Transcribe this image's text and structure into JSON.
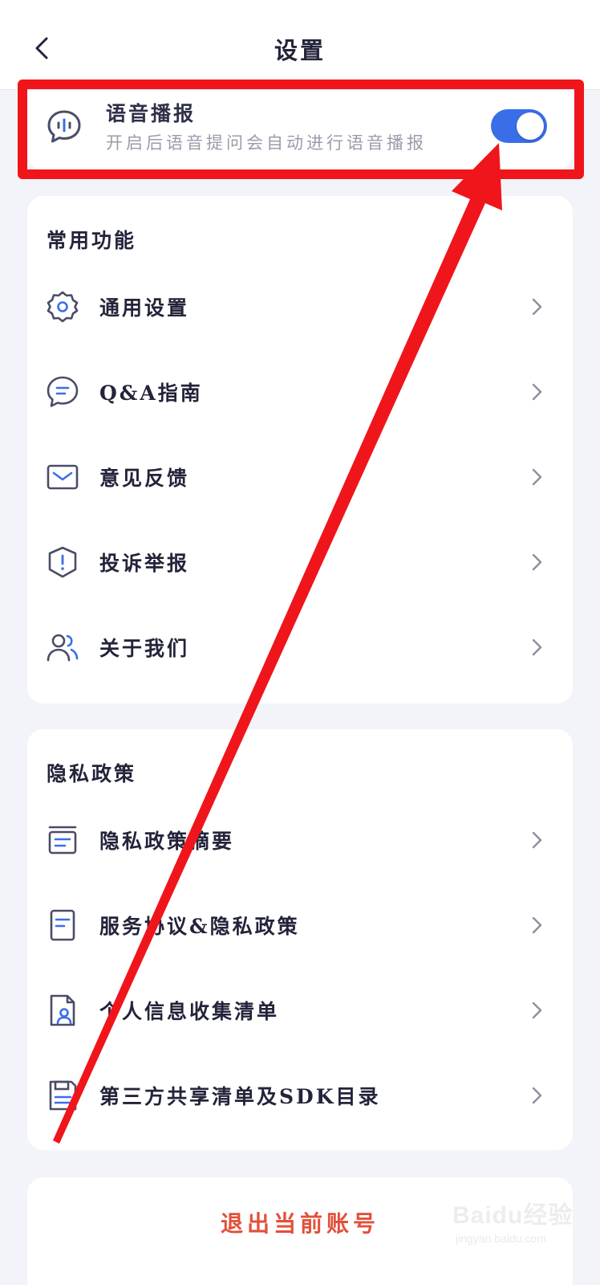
{
  "header": {
    "title": "设置"
  },
  "voice": {
    "title": "语音播报",
    "description": "开启后语音提问会自动进行语音播报",
    "enabled": true
  },
  "sections": [
    {
      "title": "常用功能",
      "items": [
        {
          "label": "通用设置",
          "icon": "gear-icon"
        },
        {
          "label": "Q&A指南",
          "icon": "chat-bubble-icon"
        },
        {
          "label": "意见反馈",
          "icon": "envelope-icon"
        },
        {
          "label": "投诉举报",
          "icon": "shield-alert-icon"
        },
        {
          "label": "关于我们",
          "icon": "users-icon"
        }
      ]
    },
    {
      "title": "隐私政策",
      "items": [
        {
          "label": "隐私政策摘要",
          "icon": "document-list-icon"
        },
        {
          "label": "服务协议&隐私政策",
          "icon": "document-icon"
        },
        {
          "label": "个人信息收集清单",
          "icon": "person-file-icon"
        },
        {
          "label": "第三方共享清单及SDK目录",
          "icon": "floppy-list-icon"
        }
      ]
    }
  ],
  "logout": {
    "label": "退出当前账号"
  },
  "annotation": {
    "highlight_color": "#f0151b"
  },
  "watermark": {
    "brand": "Baidu经验",
    "url": "jingyan.baidu.com"
  },
  "colors": {
    "accent": "#3a6ee8",
    "danger": "#e2503a",
    "icon": "#4a4c68"
  }
}
